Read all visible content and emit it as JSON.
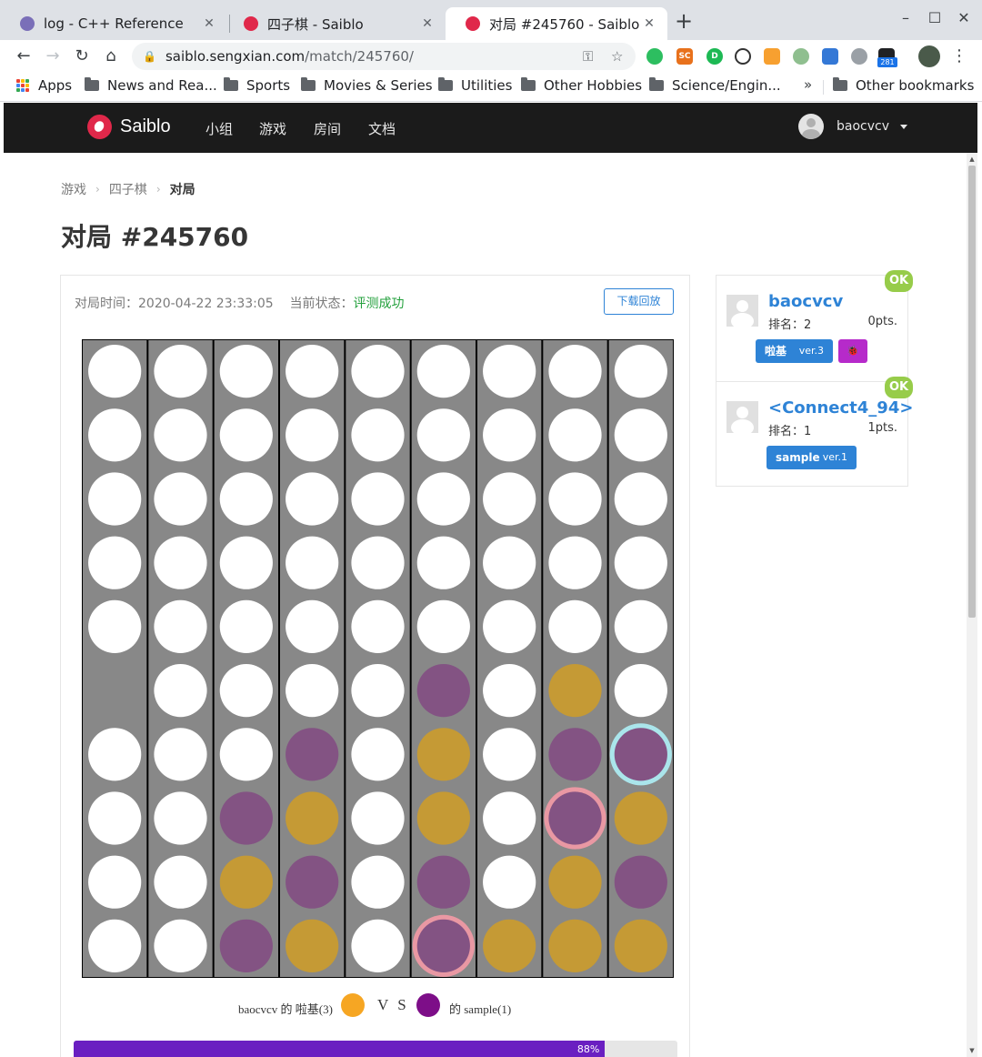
{
  "browser": {
    "tabs": [
      {
        "title": "log - C++ Reference",
        "active": false,
        "favicon_color": "#7a6fb8"
      },
      {
        "title": "四子棋 - Saiblo",
        "active": false,
        "favicon_color": "#e0284a"
      },
      {
        "title": "对局 #245760 - Saiblo",
        "active": true,
        "favicon_color": "#e0284a"
      }
    ],
    "close_glyph": "✕",
    "newtab_glyph": "+",
    "window_controls": {
      "minimize": "–",
      "maximize": "☐",
      "close": "✕"
    },
    "nav": {
      "back": "←",
      "forward": "→",
      "reload": "↻",
      "home": "⌂"
    },
    "url_host": "saiblo.sengxian.com",
    "url_path": "/match/245760/",
    "key_glyph": "⚿",
    "star_glyph": "☆",
    "extension_badge": "281",
    "bookmarks": [
      "Apps",
      "News and Rea...",
      "Sports",
      "Movies & Series",
      "Utilities",
      "Other Hobbies",
      "Science/Engin..."
    ],
    "bookmarks_overflow": "»",
    "other_bookmarks": "Other bookmarks"
  },
  "site": {
    "brand": "Saiblo",
    "nav_links": [
      "小组",
      "游戏",
      "房间",
      "文档"
    ],
    "user": "baocvcv"
  },
  "breadcrumb": [
    "游戏",
    "四子棋",
    "对局"
  ],
  "breadcrumb_sep": "›",
  "page_title": "对局 #245760",
  "match": {
    "time_label": "对局时间：",
    "time": "2020-04-22 23:33:05",
    "status_label": "当前状态：",
    "status": "评测成功",
    "replay_button": "下载回放",
    "progress_percent": 88,
    "progress_label": "88%"
  },
  "board": {
    "columns": 9,
    "rows": 10,
    "colors": {
      "bg": "#888888",
      "empty": "#ffffff",
      "gold": "#c59a35",
      "purple": "#835383"
    },
    "cells": [
      "EEEEEEEEE",
      "EEEEEEEEE",
      "EEEEEEEEE",
      "EEEEEEEEE",
      "EEEEEEEEE",
      "XEEEEPEGE",
      "EEEPEGEPP",
      "EEPGEGEPG",
      "EEGPEPEGP",
      "EEPGEPGGG"
    ],
    "highlights": [
      {
        "row": 6,
        "col": 8,
        "color": "#aef0f6"
      },
      {
        "row": 7,
        "col": 7,
        "color": "#f49aa6"
      },
      {
        "row": 9,
        "col": 5,
        "color": "#f49aa6"
      }
    ]
  },
  "versus": {
    "player1": "baocvcv 的 啦基(3)",
    "player1_color": "#f6a623",
    "vs": "V S",
    "player2": "的 sample(1)",
    "player2_color": "#7d0e88"
  },
  "players": [
    {
      "name": "baocvcv",
      "rank_label": "排名：",
      "rank": "2",
      "points": "0pts.",
      "status": "OK",
      "ai_name": "啦基",
      "ai_version": "ver.3",
      "bug_glyph": "🐞"
    },
    {
      "name": "<Connect4_94>",
      "rank_label": "排名：",
      "rank": "1",
      "points": "1pts.",
      "status": "OK",
      "ai_name": "sample",
      "ai_version": "ver.1"
    }
  ]
}
